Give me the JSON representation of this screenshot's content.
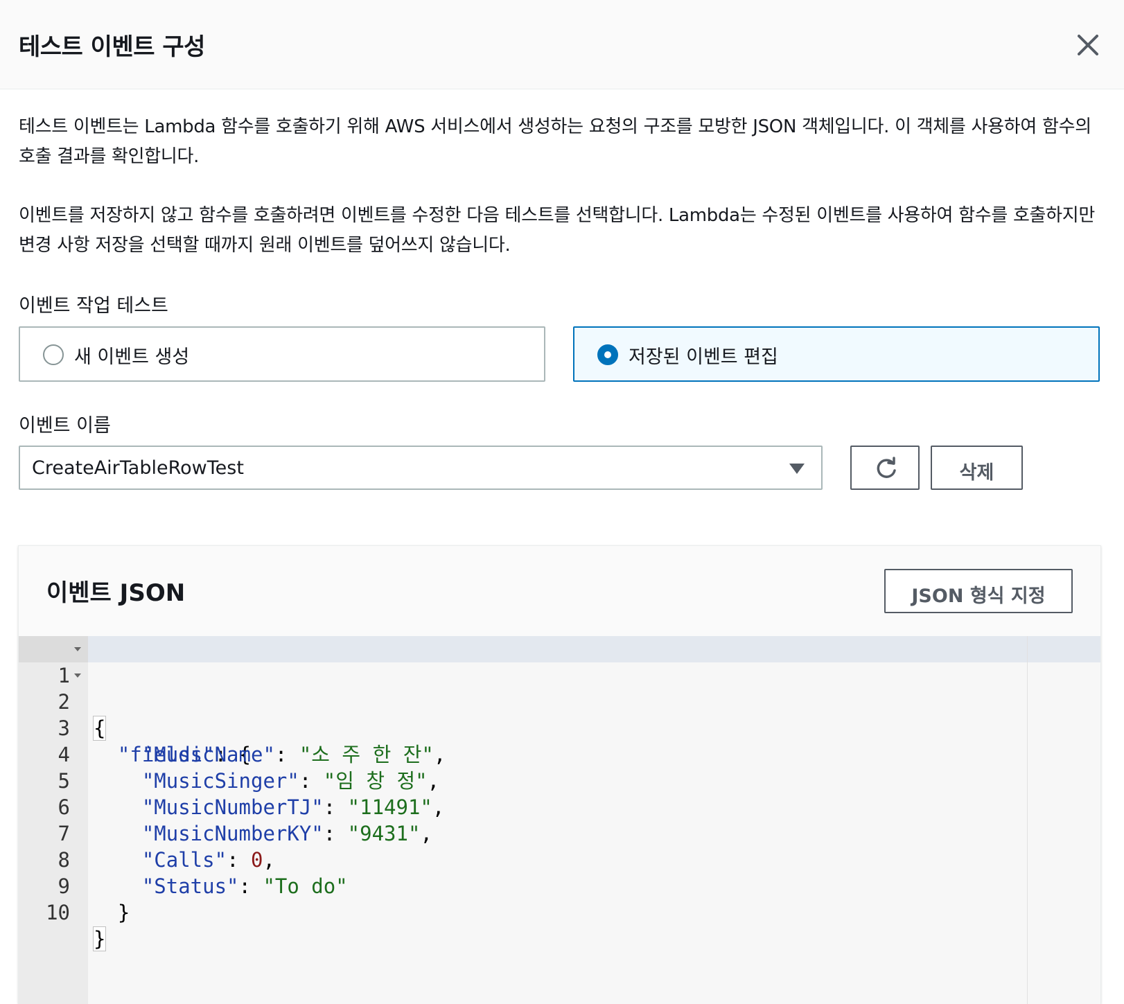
{
  "dialog": {
    "title": "테스트 이벤트 구성",
    "close_icon": "close-icon"
  },
  "description": {
    "paragraph1": "테스트 이벤트는 Lambda 함수를 호출하기 위해 AWS 서비스에서 생성하는 요청의 구조를 모방한 JSON 객체입니다. 이 객체를 사용하여 함수의 호출 결과를 확인합니다.",
    "paragraph2": "이벤트를 저장하지 않고 함수를 호출하려면 이벤트를 수정한 다음 테스트를 선택합니다. Lambda는 수정된 이벤트를 사용하여 함수를 호출하지만 변경 사항 저장을 선택할 때까지 원래 이벤트를 덮어쓰지 않습니다."
  },
  "event_action": {
    "label": "이벤트 작업 테스트",
    "options": [
      {
        "label": "새 이벤트 생성",
        "selected": false
      },
      {
        "label": "저장된 이벤트 편집",
        "selected": true
      }
    ]
  },
  "event_name": {
    "label": "이벤트 이름",
    "selected_value": "CreateAirTableRowTest",
    "delete_label": "삭제",
    "refresh_icon": "refresh-icon"
  },
  "event_json": {
    "title": "이벤트 JSON",
    "format_button_label": "JSON 형식 지정",
    "lines": [
      {
        "n": "1",
        "fold": true
      },
      {
        "n": "2",
        "fold": true
      },
      {
        "n": "3",
        "fold": false
      },
      {
        "n": "4",
        "fold": false
      },
      {
        "n": "5",
        "fold": false
      },
      {
        "n": "6",
        "fold": false
      },
      {
        "n": "7",
        "fold": false
      },
      {
        "n": "8",
        "fold": false
      },
      {
        "n": "9",
        "fold": false
      },
      {
        "n": "10",
        "fold": false
      }
    ],
    "tokens": {
      "open_brace": "{",
      "close_brace": "}",
      "fields_key": "\"fields\"",
      "music_name_key": "\"MusicName\"",
      "music_name_value": "\"소 주 한 잔\"",
      "music_singer_key": "\"MusicSinger\"",
      "music_singer_value": "\"임 창 정\"",
      "music_number_tj_key": "\"MusicNumberTJ\"",
      "music_number_tj_value": "\"11491\"",
      "music_number_ky_key": "\"MusicNumberKY\"",
      "music_number_ky_value": "\"9431\"",
      "calls_key": "\"Calls\"",
      "calls_value": "0",
      "status_key": "\"Status\"",
      "status_value": "\"To do\""
    }
  },
  "colors": {
    "accent": "#0073bb",
    "json_key": "#1f3fa8",
    "json_string": "#1d6e1d",
    "json_number": "#8b1a1a"
  }
}
